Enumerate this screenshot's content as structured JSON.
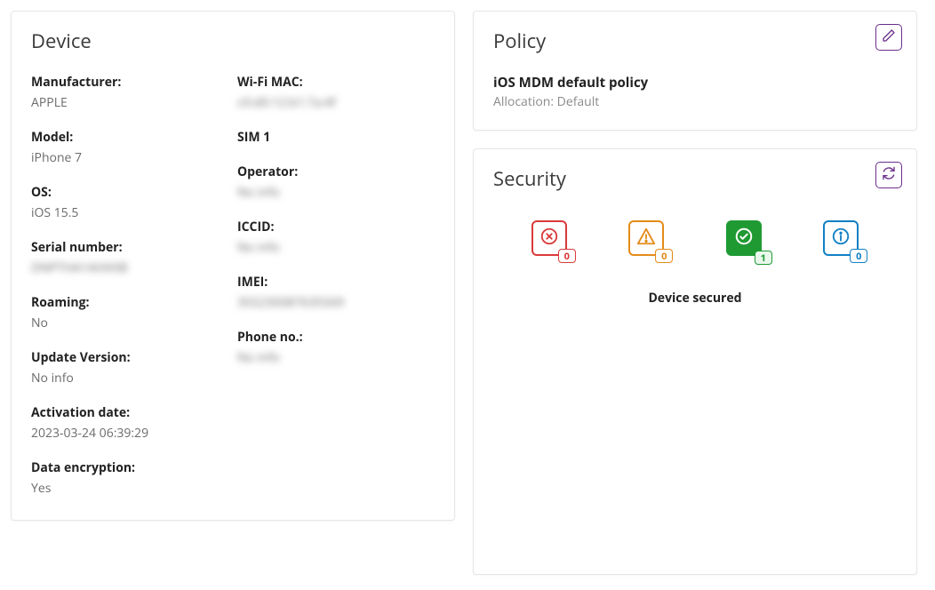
{
  "device": {
    "title": "Device",
    "left": {
      "manufacturer": {
        "label": "Manufacturer:",
        "value": "APPLE"
      },
      "model": {
        "label": "Model:",
        "value": "iPhone 7"
      },
      "os": {
        "label": "OS:",
        "value": "iOS 15.5"
      },
      "serial": {
        "label": "Serial number:",
        "value": "DNPTHA1AHXXB"
      },
      "roaming": {
        "label": "Roaming:",
        "value": "No"
      },
      "update_version": {
        "label": "Update Version:",
        "value": "No info"
      },
      "activation": {
        "label": "Activation date:",
        "value": "2023-03-24 06:39:29"
      },
      "encryption": {
        "label": "Data encryption:",
        "value": "Yes"
      }
    },
    "right": {
      "wifi_mac": {
        "label": "Wi-Fi MAC:",
        "value": "c0:d0:12:b1:7a:4f"
      },
      "sim_heading": "SIM 1",
      "operator": {
        "label": "Operator:",
        "value": "No info"
      },
      "iccid": {
        "label": "ICCID:",
        "value": "No info"
      },
      "imei": {
        "label": "IMEI:",
        "value": "355230087635569"
      },
      "phone": {
        "label": "Phone no.:",
        "value": "No info"
      }
    }
  },
  "policy": {
    "title": "Policy",
    "name": "iOS MDM default policy",
    "allocation": "Allocation: Default"
  },
  "security": {
    "title": "Security",
    "counts": {
      "error": "0",
      "warning": "0",
      "ok": "1",
      "info": "0"
    },
    "status": "Device secured"
  },
  "colors": {
    "accent": "#6a2e8a",
    "red": "#d93a3a",
    "orange": "#e38b1a",
    "green": "#1f9a33",
    "blue": "#1180c4"
  }
}
